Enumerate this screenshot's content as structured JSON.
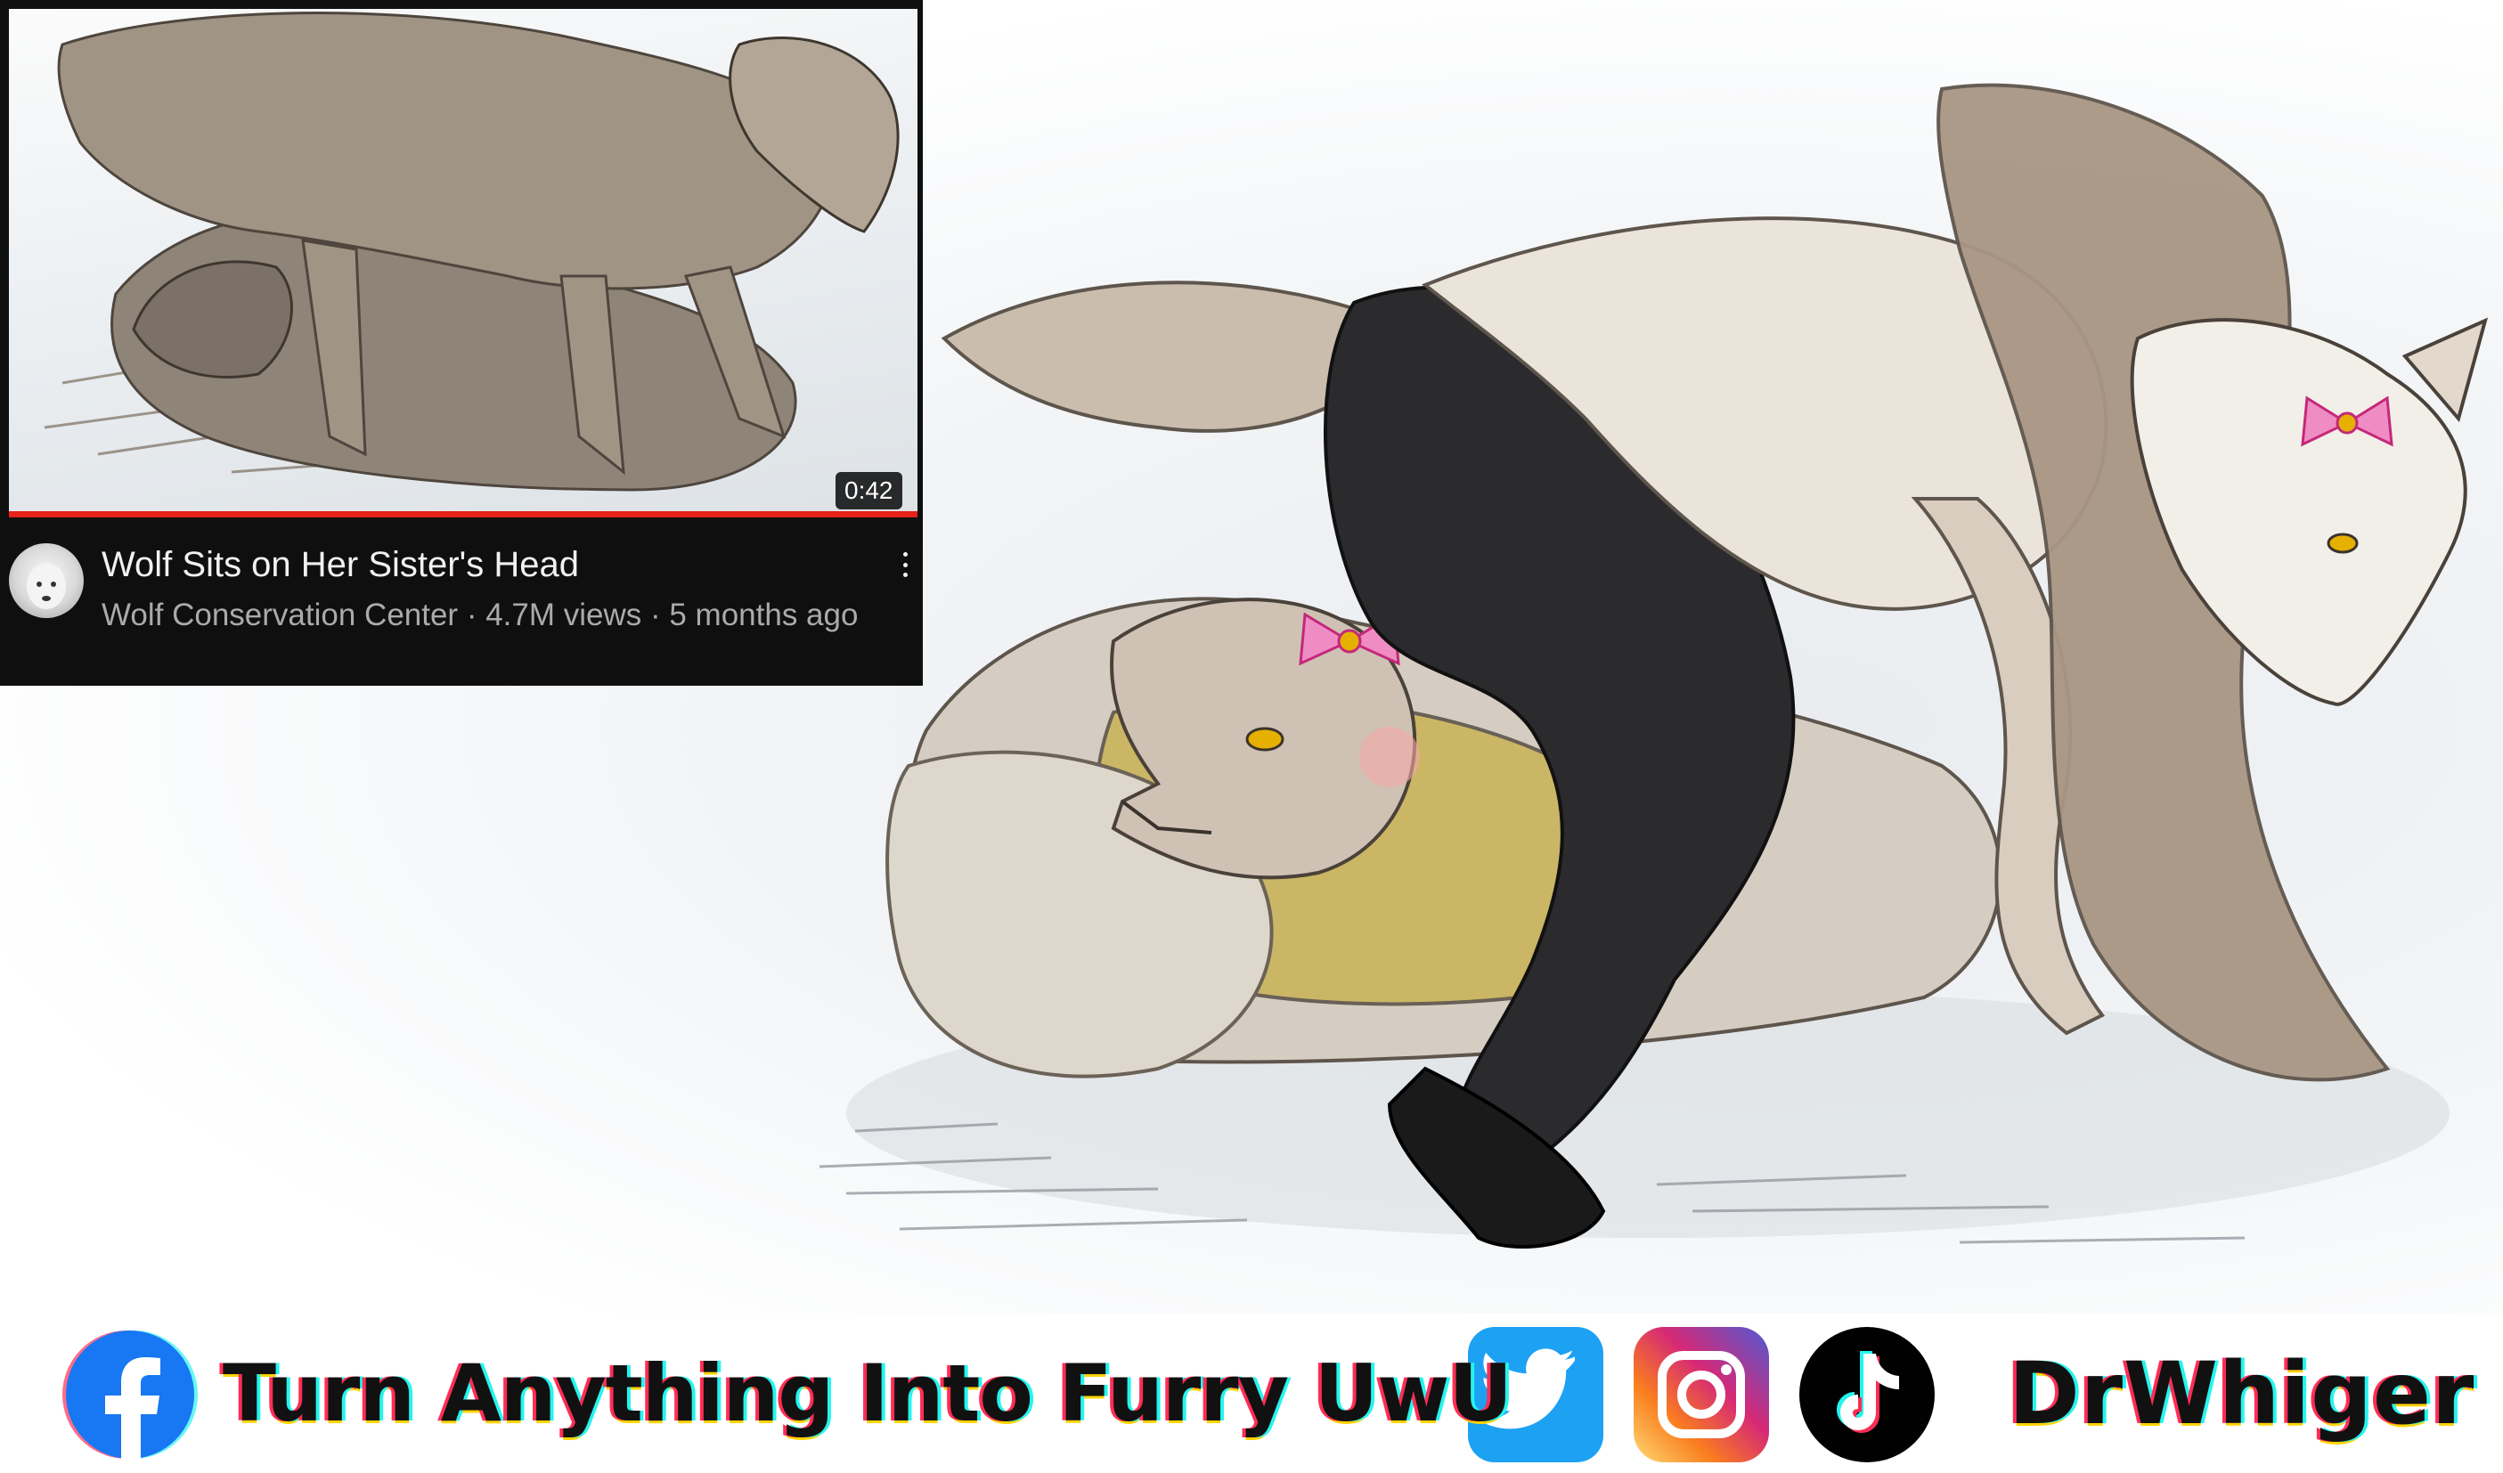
{
  "video_card": {
    "duration": "0:42",
    "title": "Wolf Sits on Her Sister's Head",
    "meta": "Wolf Conservation Center · 4.7M views · 5 months ago"
  },
  "footer": {
    "tagline": "Turn Anything Into Furry UwU",
    "handle": "DrWhiger",
    "icons": [
      "facebook-icon",
      "twitter-icon",
      "instagram-icon",
      "tiktok-icon"
    ]
  },
  "colors": {
    "youtube_bg": "#0f0f0f",
    "progress_red": "#e62117",
    "facebook_blue": "#1877f2",
    "twitter_blue": "#1da1f2"
  }
}
